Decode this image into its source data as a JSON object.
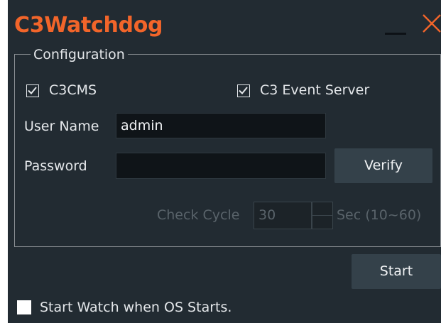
{
  "window": {
    "title": "C3Watchdog",
    "minimize_icon": "minimize-icon",
    "close_icon": "close-icon",
    "accent_color": "#f2652a",
    "background_color": "#222b32"
  },
  "configuration": {
    "group_label": "Configuration",
    "c3cms": {
      "label": "C3CMS",
      "checked": true
    },
    "event_server": {
      "label": "C3 Event Server",
      "checked": true
    },
    "username": {
      "label": "User Name",
      "value": "admin"
    },
    "password": {
      "label": "Password",
      "value": ""
    },
    "verify_label": "Verify",
    "check_cycle": {
      "label": "Check Cycle",
      "value": "30",
      "unit": "Sec (10~60)",
      "enabled": false
    }
  },
  "start_label": "Start",
  "start_with_os": {
    "label": "Start Watch when OS Starts.",
    "checked": false
  }
}
